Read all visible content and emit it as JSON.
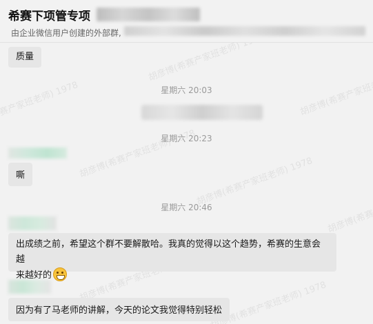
{
  "header": {
    "title": "希赛下项管专项",
    "subtitle": "由企业微信用户创建的外部群,"
  },
  "watermark": "胡彦博(希赛产家班老师) 1978",
  "messages": [
    {
      "text": "质量"
    },
    {
      "text": "嘶"
    },
    {
      "text": "出成绩之前，希望这个群不要解散哈。我真的觉得以这个趋势，希赛的生意会越",
      "text2": "来越好的"
    },
    {
      "text": "因为有了马老师的讲解，今天的论文我觉得特别轻松"
    }
  ],
  "timestamps": [
    "星期六 20:03",
    "星期六 20:23",
    "星期六 20:46"
  ],
  "emoji_icon": "grinning-face-icon"
}
